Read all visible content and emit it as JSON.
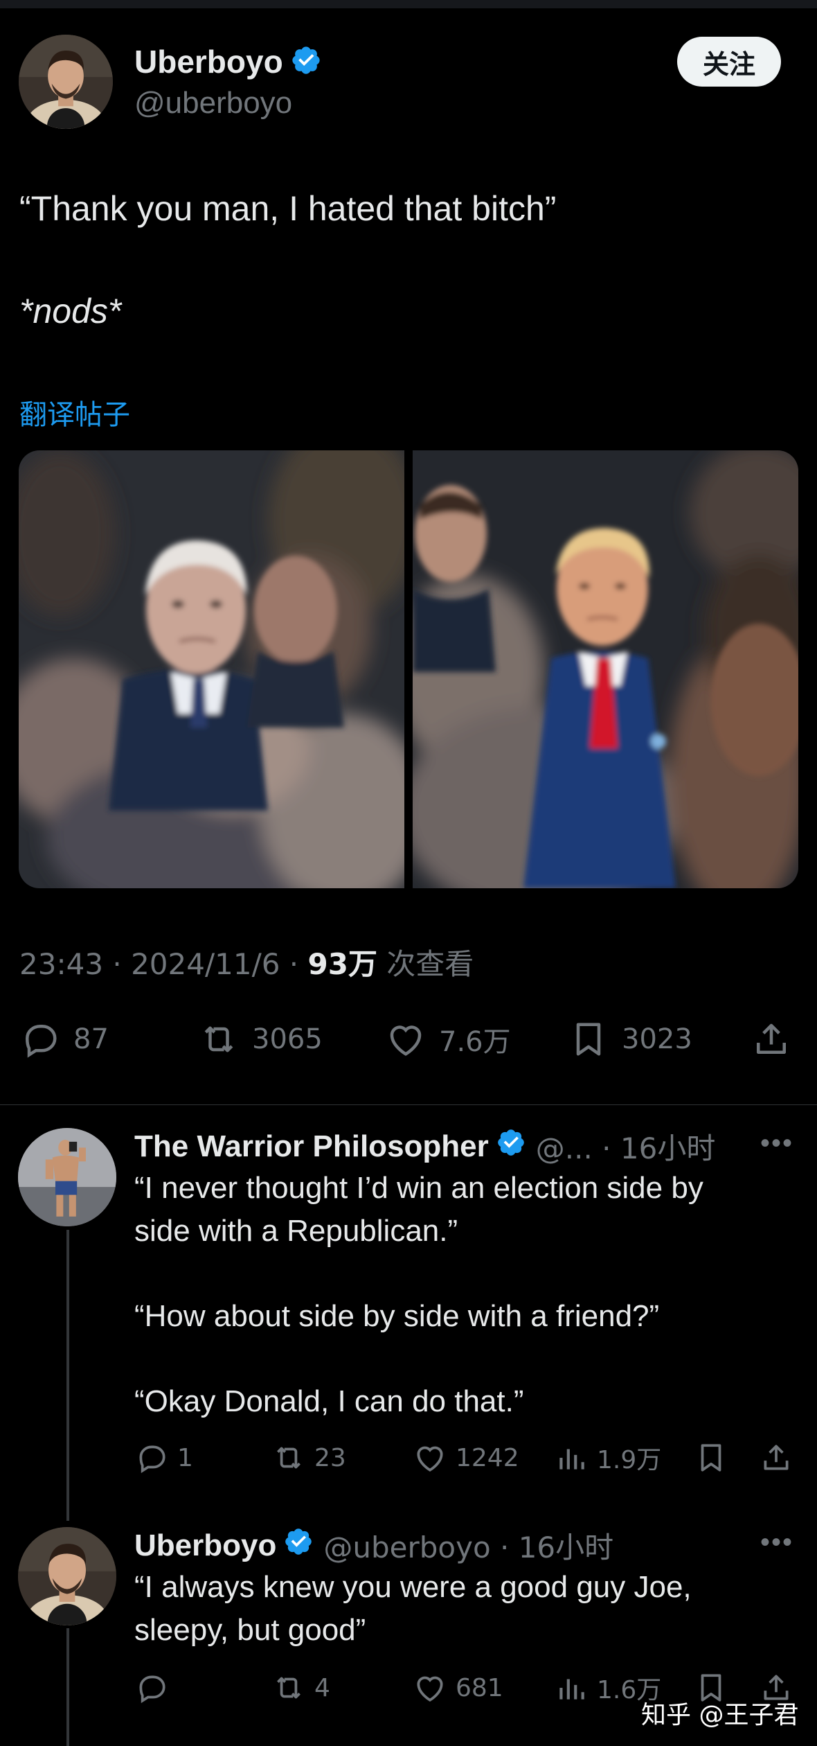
{
  "accent_color": "#1d9bf0",
  "main_tweet": {
    "author": {
      "name": "Uberboyo",
      "handle": "@uberboyo",
      "verified": true
    },
    "follow_label": "关注",
    "text_line_1": "“Thank you man, I hated that bitch”",
    "text_line_2": "*nods*",
    "translate_label": "翻译帖子",
    "time": "23:43 · 2024/11/6 · ",
    "views": "93万",
    "views_suffix": " 次查看",
    "stats": {
      "replies": "87",
      "retweets": "3065",
      "likes": "7.6万",
      "bookmarks": "3023"
    }
  },
  "replies": [
    {
      "name": "The Warrior Philosopher",
      "meta": "@... · 16小时",
      "verified": true,
      "lines": [
        "“I never thought I’d win an election side by",
        "side with a Republican.”",
        "",
        "“How about side by side with a friend?”",
        "",
        "“Okay Donald, I can do that.”"
      ],
      "stats": {
        "replies": "1",
        "retweets": "23",
        "likes": "1242",
        "views": "1.9万"
      }
    },
    {
      "name": "Uberboyo",
      "meta": "@uberboyo · 16小时",
      "verified": true,
      "lines": [
        "“I always knew you were a good guy Joe,",
        "sleepy, but good”"
      ],
      "stats": {
        "replies": "",
        "retweets": "4",
        "likes": "681",
        "views": "1.6万"
      }
    }
  ],
  "watermark": "知乎 @王子君"
}
